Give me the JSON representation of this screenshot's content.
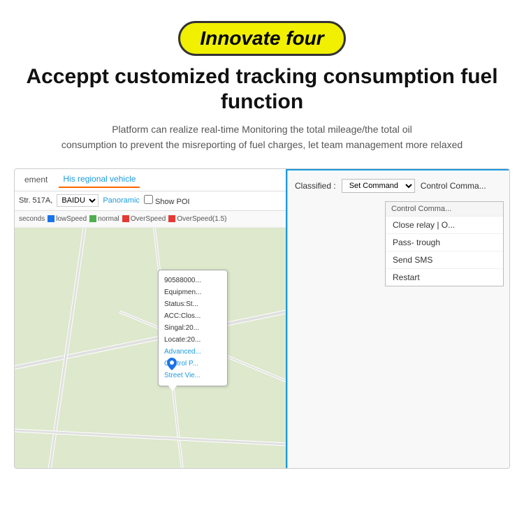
{
  "badge": {
    "text": "Innovate four"
  },
  "titles": {
    "main": "Acceppt customized tracking consumption fuel function",
    "sub_line1": "Platform can realize real-time Monitoring  the total mileage/the total oil",
    "sub_line2": "consumption to prevent the misreporting of fuel charges, let team management more relaxed"
  },
  "map_panel": {
    "tab_ement": "ement",
    "tab_regional": "His regional vehicle",
    "toolbar_street": "Str. 517A,",
    "toolbar_baidu": "BAIDU",
    "toolbar_panoramic": "Panoramic",
    "toolbar_show_poi": "Show POI",
    "legend_seconds": "seconds",
    "legend_items": [
      {
        "label": "normal",
        "color": "#4CAF50"
      },
      {
        "label": "OverSpeed",
        "color": "#e53935"
      },
      {
        "label": "OverSpeed(1.5)",
        "color": "#e53935"
      }
    ],
    "legend_low_speed": "lowSpeed"
  },
  "map_popup": {
    "id": "90588000...",
    "equipment": "Equipmen...",
    "status": "Status:St...",
    "acc": "ACC:Clos...",
    "signal": "Singal:20...",
    "locate": "Locate:20...",
    "link1": "Advanced...",
    "link2": "Control P...",
    "link3": "Street Vie..."
  },
  "right_panel": {
    "classified_label": "Classified :",
    "set_command_label": "Set Command",
    "control_command_label": "Control Comma...",
    "dropdown_items": [
      "Close relay | O...",
      "Pass- trough",
      "Send SMS",
      "Restart"
    ]
  }
}
